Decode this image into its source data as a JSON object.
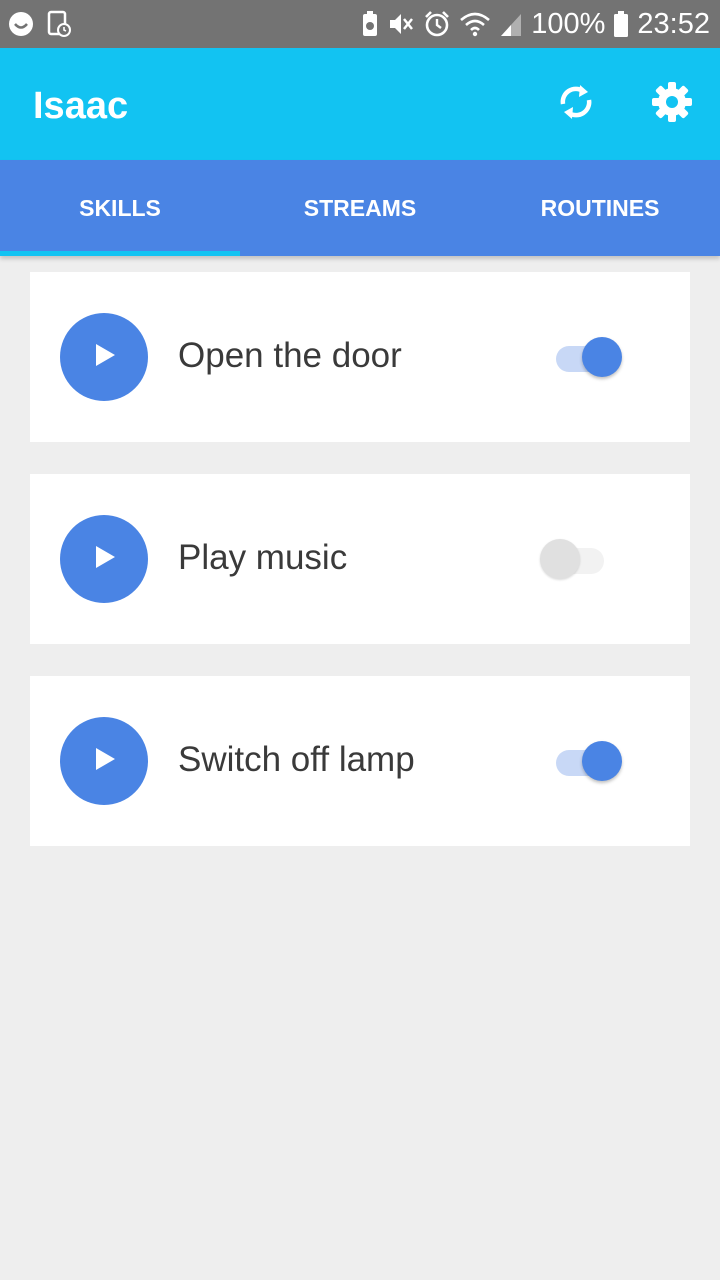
{
  "status_bar": {
    "battery_percent": "100%",
    "time": "23:52",
    "icons": [
      "smiley-icon",
      "screenshot-icon",
      "battery-saver-icon",
      "mute-icon",
      "alarm-icon",
      "wifi-icon",
      "signal-icon",
      "battery-icon"
    ]
  },
  "app_bar": {
    "title": "Isaac",
    "actions": [
      "refresh-icon",
      "gear-icon"
    ]
  },
  "tabs": [
    {
      "label": "SKILLS",
      "selected": true
    },
    {
      "label": "STREAMS",
      "selected": false
    },
    {
      "label": "ROUTINES",
      "selected": false
    }
  ],
  "skills": [
    {
      "label": "Open the door",
      "enabled": true
    },
    {
      "label": "Play music",
      "enabled": false
    },
    {
      "label": "Switch off lamp",
      "enabled": true
    }
  ],
  "colors": {
    "status_bar": "#737373",
    "app_bar": "#12c3f2",
    "tab_bar": "#4a84e4",
    "accent": "#4a84e4",
    "background": "#eeeeee"
  }
}
